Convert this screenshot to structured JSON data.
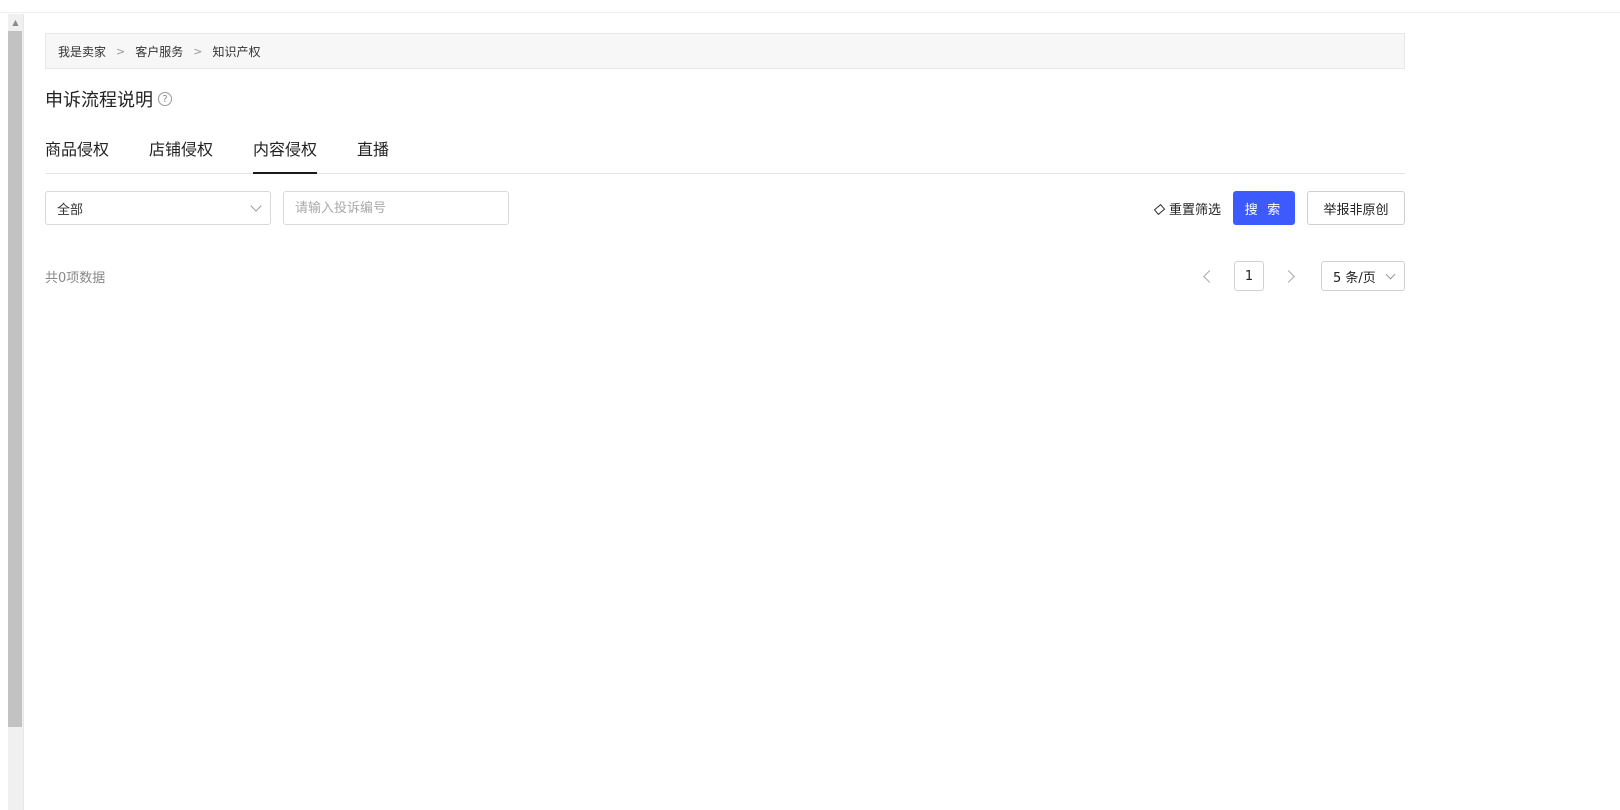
{
  "breadcrumb": {
    "items": [
      "我是卖家",
      "客户服务",
      "知识产权"
    ],
    "separator": ">"
  },
  "page": {
    "title": "申诉流程说明",
    "help_icon": "question-circle-icon"
  },
  "tabs": [
    {
      "label": "商品侵权",
      "active": false
    },
    {
      "label": "店铺侵权",
      "active": false
    },
    {
      "label": "内容侵权",
      "active": true
    },
    {
      "label": "直播",
      "active": false
    }
  ],
  "filters": {
    "status_select": "全部",
    "complaint_id_placeholder": "请输入投诉编号",
    "reset_label": "重置筛选",
    "search_label": "搜 索",
    "report_label": "举报非原创"
  },
  "pagination": {
    "total_text": "共0项数据",
    "current_page": "1",
    "page_size": "5 条/页"
  },
  "colors": {
    "primary": "#3d5afe",
    "tab_active_underline": "#1a1a1a"
  }
}
